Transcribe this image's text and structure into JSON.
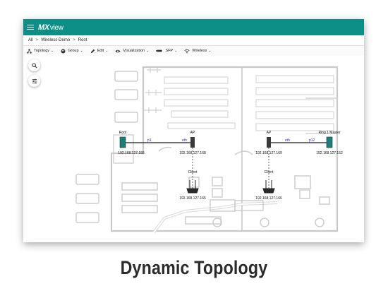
{
  "app": {
    "logo_mx": "MX",
    "logo_view": "view"
  },
  "breadcrumb": [
    "All",
    "Wireless-Demo",
    "Root"
  ],
  "breadcrumb_sep": ">",
  "toolbar": [
    {
      "label": "Topology",
      "icon": "topology-icon"
    },
    {
      "label": "Group",
      "icon": "group-icon"
    },
    {
      "label": "Edit",
      "icon": "pencil-icon"
    },
    {
      "label": "Visualization",
      "icon": "eye-icon"
    },
    {
      "label": "SFP",
      "icon": "sfp-icon"
    },
    {
      "label": "Wireless",
      "icon": "wifi-icon"
    }
  ],
  "canvas_tools": {
    "search": "search-icon",
    "filter": "filter-sliders-icon"
  },
  "devices": [
    {
      "title": "Root",
      "ip": "192.168.127.155"
    },
    {
      "title": "AP",
      "ip": "192.168.127.168"
    },
    {
      "title": "AP",
      "ip": "192.168.127.169"
    },
    {
      "title": "Ring 1 Master",
      "ip": "192.168.127.152"
    },
    {
      "title": "Client",
      "ip": "192.168.127.165"
    },
    {
      "title": "Client",
      "ip": "192.168.127.166"
    }
  ],
  "links": [
    "p1",
    "eth",
    "eth",
    "p12"
  ],
  "caption": "Dynamic Topology",
  "colors": {
    "appbar": "#0d8f88",
    "link": "#2c2cd0",
    "device": "#1f7f78"
  }
}
